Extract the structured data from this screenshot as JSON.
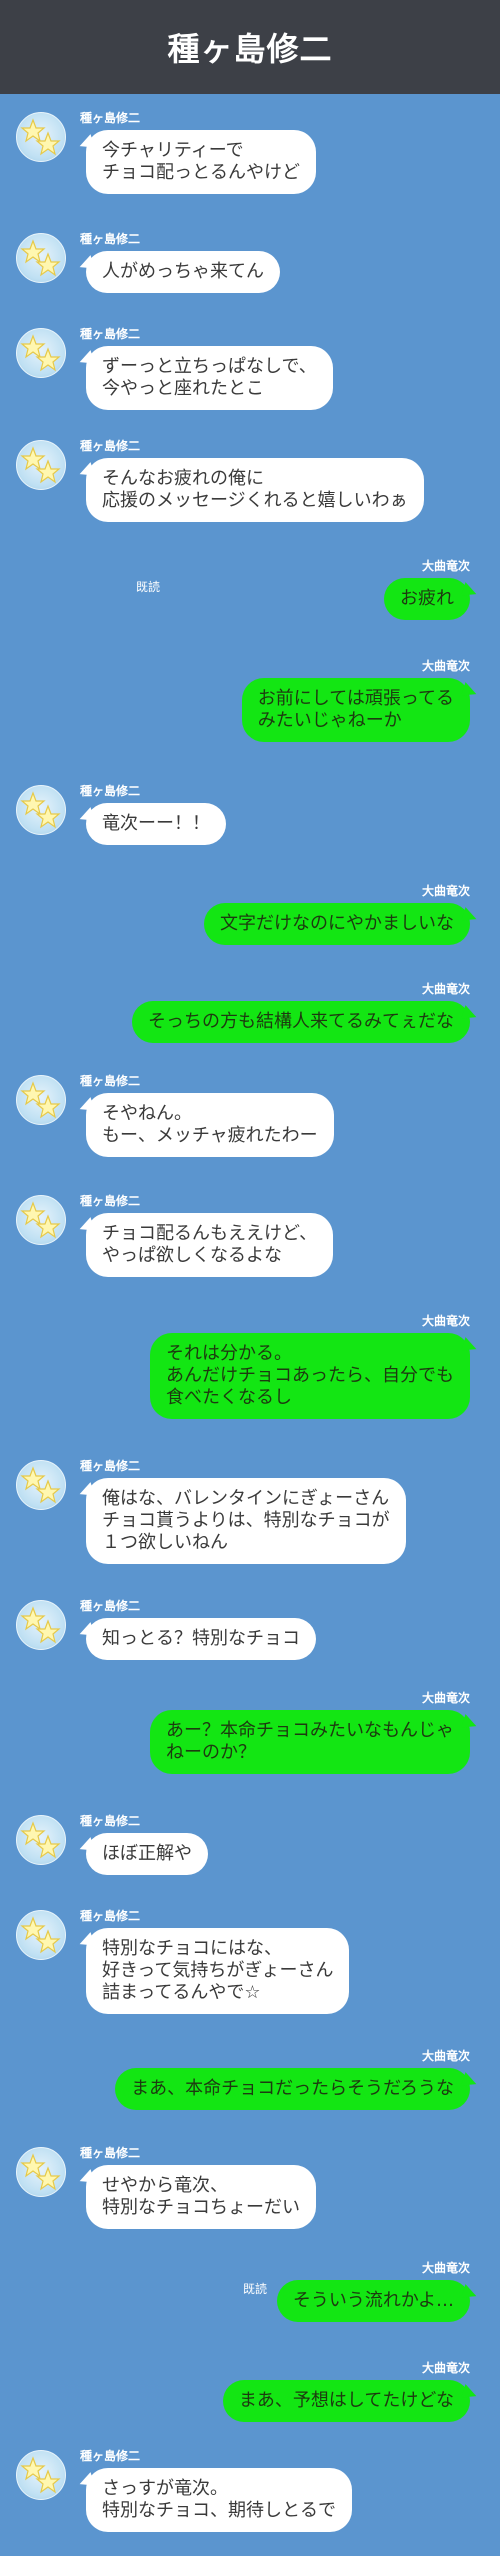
{
  "header": {
    "title": "種ヶ島修二"
  },
  "names": {
    "left": "種ヶ島修二",
    "right": "大曲竜次"
  },
  "read_label": "既読",
  "messages": [
    {
      "side": "in",
      "text": "今チャリティーで\nチョコ配っとるんやけど"
    },
    {
      "side": "in",
      "text": "人がめっちゃ来てん"
    },
    {
      "side": "in",
      "text": "ずーっと立ちっぱなしで、\n今やっと座れたとこ"
    },
    {
      "side": "in",
      "text": "そんなお疲れの俺に\n応援のメッセージくれると嬉しいわぁ"
    },
    {
      "side": "out",
      "text": "お疲れ"
    },
    {
      "side": "out",
      "text": "お前にしては頑張ってる\nみたいじゃねーか"
    },
    {
      "side": "in",
      "text": "竜次ーー！！"
    },
    {
      "side": "out",
      "text": "文字だけなのにやかましいな"
    },
    {
      "side": "out",
      "text": "そっちの方も結構人来てるみてぇだな"
    },
    {
      "side": "in",
      "text": "そやねん。\nもー、メッチャ疲れたわー"
    },
    {
      "side": "in",
      "text": "チョコ配るんもええけど、\nやっぱ欲しくなるよな"
    },
    {
      "side": "out",
      "text": "それは分かる。\nあんだけチョコあったら、自分でも\n食べたくなるし"
    },
    {
      "side": "in",
      "text": "俺はな、バレンタインにぎょーさん\nチョコ貰うよりは、特別なチョコが\n１つ欲しいねん"
    },
    {
      "side": "in",
      "text": "知っとる？特別なチョコ"
    },
    {
      "side": "out",
      "text": "あー？本命チョコみたいなもんじゃ\nねーのか？"
    },
    {
      "side": "in",
      "text": "ほぼ正解や"
    },
    {
      "side": "in",
      "text": "特別なチョコにはな、\n好きって気持ちがぎょーさん\n詰まってるんやで☆"
    },
    {
      "side": "out",
      "text": "まあ、本命チョコだったらそうだろうな"
    },
    {
      "side": "in",
      "text": "せやから竜次、\n特別なチョコちょーだい"
    },
    {
      "side": "out",
      "text": "そういう流れかよ…"
    },
    {
      "side": "out",
      "text": "まあ、予想はしてたけどな"
    },
    {
      "side": "in",
      "text": "さっすが竜次。\n特別なチョコ、期待しとるで"
    }
  ]
}
